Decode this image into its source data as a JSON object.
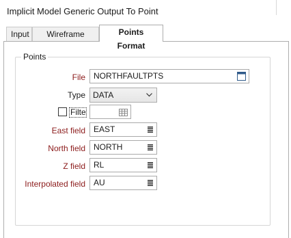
{
  "window": {
    "title": "Implicit Model Generic Output To Point"
  },
  "tabs": [
    {
      "label": "Input"
    },
    {
      "label": "Wireframe Format"
    },
    {
      "label": "Points Format"
    }
  ],
  "points_group": {
    "label": "Points",
    "file": {
      "label": "File",
      "value": "NORTHFAULTPTS"
    },
    "type": {
      "label": "Type",
      "value": "DATA"
    },
    "filter": {
      "label": "Filter",
      "checked": false,
      "value": ""
    },
    "east_field": {
      "label": "East field",
      "value": "EAST"
    },
    "north_field": {
      "label": "North field",
      "value": "NORTH"
    },
    "z_field": {
      "label": "Z field",
      "value": "RL"
    },
    "interpolated_field": {
      "label": "Interpolated field",
      "value": "AU"
    }
  }
}
